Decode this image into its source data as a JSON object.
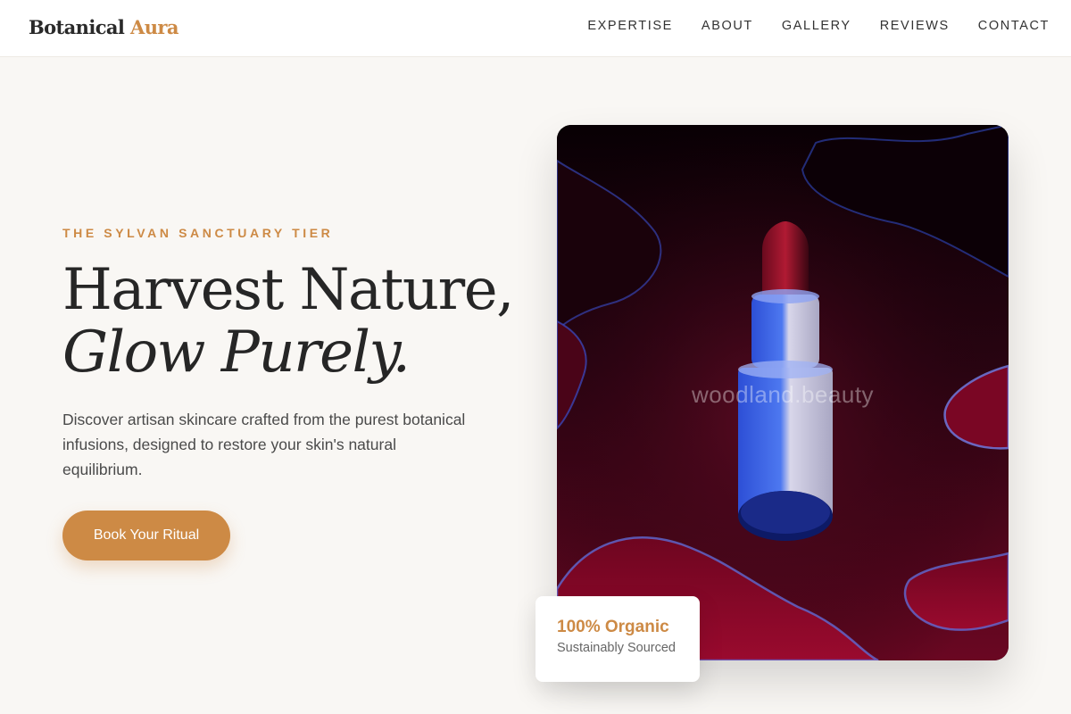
{
  "header": {
    "brand_primary": "Botanical",
    "brand_accent": "Aura",
    "nav": [
      "EXPERTISE",
      "ABOUT",
      "GALLERY",
      "REVIEWS",
      "CONTACT"
    ]
  },
  "hero": {
    "eyebrow": "THE SYLVAN SANCTUARY TIER",
    "headline_line1": "Harvest Nature,",
    "headline_line2": "Glow Purely.",
    "description": "Discover artisan skincare crafted from the purest botanical infusions, designed to restore your skin's natural equilibrium.",
    "cta_label": "Book Your Ritual",
    "image_watermark": "woodland.beauty"
  },
  "badge": {
    "title": "100% Organic",
    "subtitle": "Sustainably Sourced"
  },
  "colors": {
    "accent": "#cd8a45",
    "background": "#f9f7f4",
    "text": "#262626"
  }
}
